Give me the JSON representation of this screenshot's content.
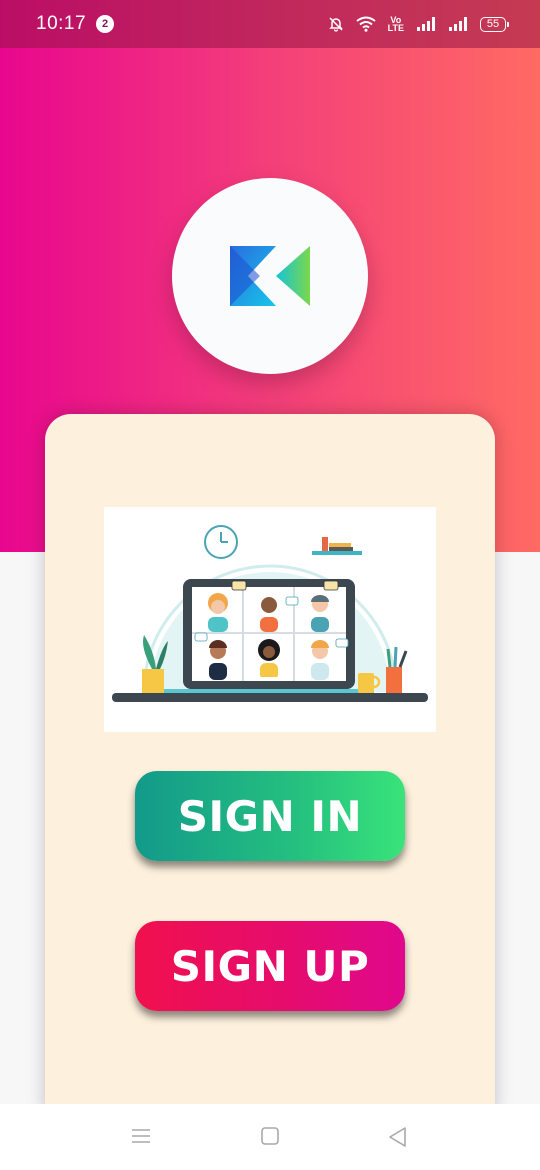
{
  "status_bar": {
    "time": "10:17",
    "notification_count": "2",
    "network_label_top": "Vo",
    "network_label_bottom": "LTE",
    "battery": "55"
  },
  "colors": {
    "header_gradient": [
      "#e8068e",
      "#ff6a63"
    ],
    "card_background": "#fdf0dd",
    "sign_in_gradient": [
      "#129a8a",
      "#39e37a"
    ],
    "sign_up_gradient": [
      "#f0104e",
      "#e0088c"
    ]
  },
  "logo": {
    "icon": "app-logo-k"
  },
  "illustration": {
    "description_icon": "video-conference-illustration"
  },
  "buttons": {
    "sign_in": "SIGN IN",
    "sign_up": "SIGN UP"
  },
  "nav": {
    "icons": [
      "menu-icon",
      "home-icon",
      "back-icon"
    ]
  }
}
